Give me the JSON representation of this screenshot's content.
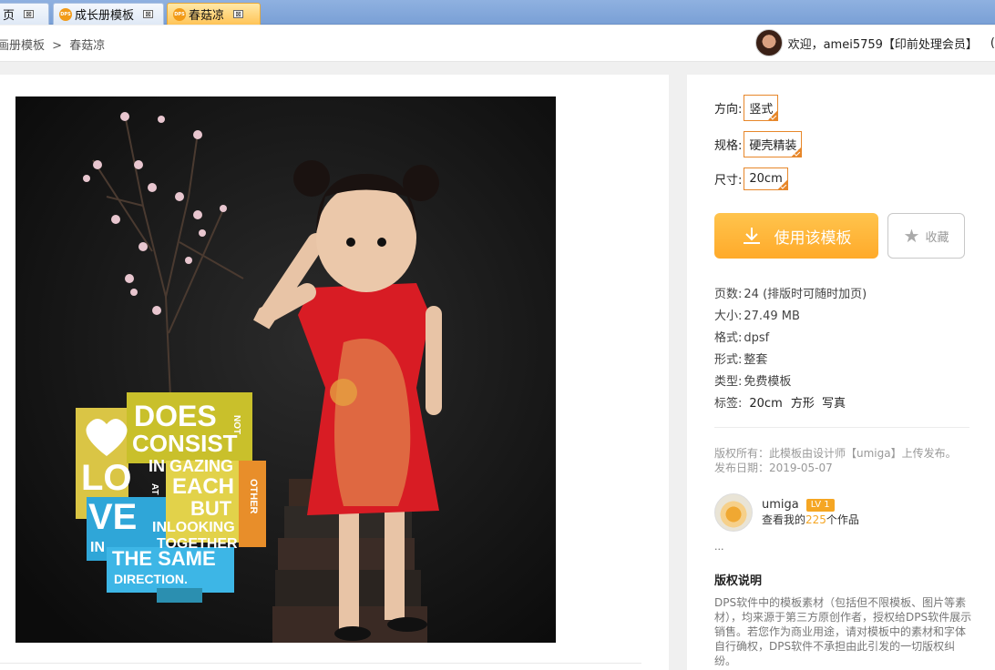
{
  "tabs": [
    {
      "label": "页"
    },
    {
      "label": "成长册模板",
      "badge": "DPS"
    },
    {
      "label": "春菇凉",
      "badge": "DPS",
      "active": true
    }
  ],
  "tab_close": "⊠",
  "breadcrumb": {
    "parent": "画册模板",
    "sep": ">",
    "current": "春菇凉"
  },
  "user": {
    "greeting": "欢迎，amei5759【印前处理会员】",
    "paren": "("
  },
  "options": {
    "direction": {
      "label": "方向:",
      "value": "竖式"
    },
    "spec": {
      "label": "规格:",
      "value": "硬壳精装"
    },
    "size": {
      "label": "尺寸:",
      "value": "20cm"
    }
  },
  "use_button": "使用该模板",
  "fav_button": "收藏",
  "info": {
    "pages": {
      "k": "页数:",
      "v": "24 (排版时可随时加页)"
    },
    "filesize": {
      "k": "大小:",
      "v": "27.49 MB"
    },
    "format": {
      "k": "格式:",
      "v": "dpsf"
    },
    "form": {
      "k": "形式:",
      "v": "整套"
    },
    "type": {
      "k": "类型:",
      "v": "免费模板"
    },
    "tags": {
      "k": "标签:",
      "values": [
        "20cm",
        "方形",
        "写真"
      ]
    }
  },
  "meta": {
    "copyright": "版权所有：此模板由设计师【umiga】上传发布。",
    "date": "发布日期：2019-05-07"
  },
  "author": {
    "name": "umiga",
    "level": "LV 1",
    "works_prefix": "查看我的",
    "works_count": "225",
    "works_suffix": "个作品"
  },
  "ellipsis": "...",
  "copyright_title": "版权说明",
  "copyright_text": "DPS软件中的模板素材（包括但不限模板、图片等素材），均来源于第三方原创作者，授权给DPS软件展示销售。若您作为商业用途，请对模板中的素材和字体自行确权，DPS软件不承担由此引发的一切版权纠纷。",
  "poster": {
    "line1": "DOES",
    "line2": "CONSIST",
    "line3": "IN GAZING",
    "line4": "EACH",
    "line5": "BUT",
    "line6": "INLOOKING",
    "line7": "TOGETHER",
    "line8": "IN",
    "line9": "THE SAME",
    "line10": "DIRECTION.",
    "not": "NOT",
    "other": "OTHER",
    "at": "AT",
    "lo": "LO",
    "ve": "VE"
  },
  "colors": {
    "accent": "#ffaa2a",
    "option_border": "#e7872a",
    "tab_active": "#ffc457"
  }
}
